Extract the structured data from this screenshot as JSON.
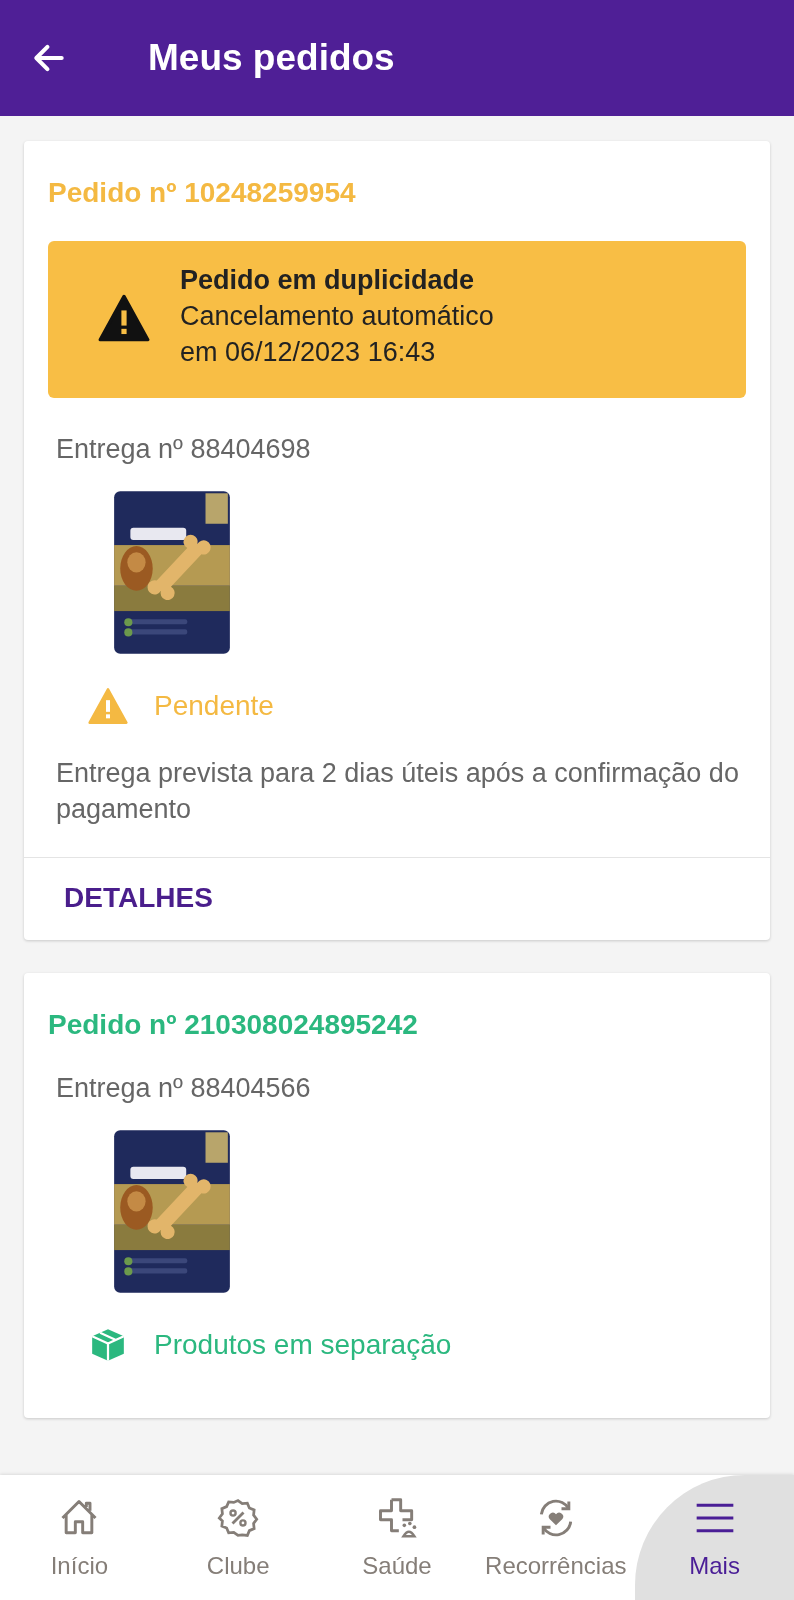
{
  "header": {
    "title": "Meus pedidos"
  },
  "orders": [
    {
      "number": "Pedido nº 10248259954",
      "color": "#f4b942",
      "alert": {
        "title": "Pedido em duplicidade",
        "lines": [
          "Cancelamento automático",
          "em 06/12/2023 16:43"
        ]
      },
      "delivery": "Entrega nº 88404698",
      "status": {
        "kind": "warning",
        "label": "Pendente",
        "color": "#f4b942"
      },
      "note": "Entrega prevista para 2 dias úteis após a confirmação do pagamento",
      "action": "DETALHES"
    },
    {
      "number": "Pedido nº 210308024895242",
      "color": "#2bb87f",
      "delivery": "Entrega nº 88404566",
      "status": {
        "kind": "box",
        "label": "Produtos em separação",
        "color": "#2bb87f"
      }
    }
  ],
  "nav": [
    {
      "kind": "home",
      "label": "Início",
      "selected": false
    },
    {
      "kind": "club",
      "label": "Clube",
      "selected": false
    },
    {
      "kind": "health",
      "label": "Saúde",
      "selected": false
    },
    {
      "kind": "recurring",
      "label": "Recorrências",
      "selected": false
    },
    {
      "kind": "menu",
      "label": "Mais",
      "selected": true
    }
  ]
}
